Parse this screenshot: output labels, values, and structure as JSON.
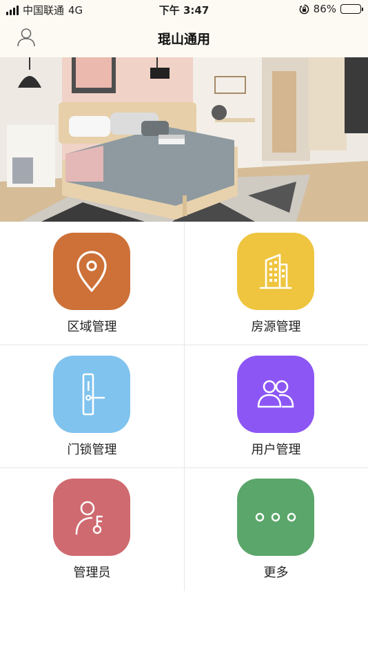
{
  "status_bar": {
    "carrier": "中国联通",
    "network": "4G",
    "time": "下午 3:47",
    "battery": "86%",
    "battery_level": 0.86
  },
  "header": {
    "title": "琨山通用",
    "user_icon": "user-icon"
  },
  "banner": {
    "icon": "bedroom-photo"
  },
  "menu": [
    {
      "label": "区域管理",
      "icon": "location-pin-icon",
      "color": "#cd7138"
    },
    {
      "label": "房源管理",
      "icon": "building-icon",
      "color": "#efc53f"
    },
    {
      "label": "门锁管理",
      "icon": "door-lock-icon",
      "color": "#7fc3ee"
    },
    {
      "label": "用户管理",
      "icon": "users-icon",
      "color": "#8c56f5"
    },
    {
      "label": "管理员",
      "icon": "admin-key-icon",
      "color": "#cf6a70"
    },
    {
      "label": "更多",
      "icon": "more-icon",
      "color": "#5ba66b"
    }
  ]
}
